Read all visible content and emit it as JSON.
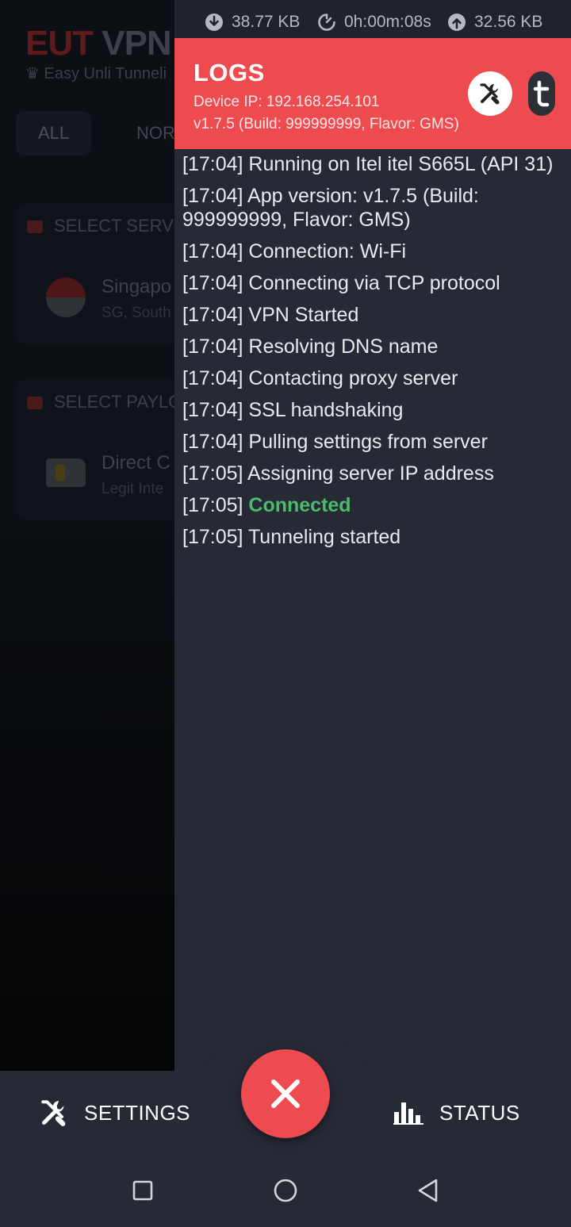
{
  "background_app": {
    "title_part1": "EUT",
    "title_part2": "VPN",
    "subtitle": "♛ Easy Unli Tunneli",
    "tabs": [
      "ALL",
      "NOR"
    ],
    "server_section": "SELECT SERV",
    "server_name": "Singapo",
    "server_sub": "SG, South",
    "payload_section": "SELECT PAYLO",
    "payload_name": "Direct C",
    "payload_sub": "Legit Inte"
  },
  "status_bar": {
    "download": "38.77 KB",
    "duration": "0h:00m:08s",
    "upload": "32.56 KB"
  },
  "logs": {
    "title": "LOGS",
    "device_ip": "Device IP: 192.168.254.101",
    "version_info": "v1.7.5 (Build: 999999999, Flavor: GMS)",
    "entries": [
      {
        "time": "[17:04]",
        "message": "Running on Itel itel S665L (API 31)"
      },
      {
        "time": "[17:04]",
        "message": "App version: v1.7.5 (Build: 999999999, Flavor: GMS)"
      },
      {
        "time": "[17:04]",
        "message": "Connection: Wi-Fi"
      },
      {
        "time": "[17:04]",
        "message": "Connecting via TCP protocol"
      },
      {
        "time": "[17:04]",
        "message": "VPN Started"
      },
      {
        "time": "[17:04]",
        "message": "Resolving DNS name"
      },
      {
        "time": "[17:04]",
        "message": "Contacting proxy server"
      },
      {
        "time": "[17:04]",
        "message": "SSL handshaking"
      },
      {
        "time": "[17:04]",
        "message": "Pulling settings from server"
      },
      {
        "time": "[17:05]",
        "message": "Assigning server IP address"
      },
      {
        "time": "[17:05]",
        "message": "Connected"
      },
      {
        "time": "[17:05]",
        "message": "Tunneling started"
      }
    ]
  },
  "bottom_bar": {
    "settings_label": "SETTINGS",
    "status_label": "STATUS"
  },
  "colors": {
    "accent": "#ee4b50",
    "drawer_bg": "#262a35",
    "connected_green": "#4cbb6c"
  },
  "icons": {
    "download": "download-icon",
    "timer": "timer-icon",
    "upload": "upload-icon",
    "tools": "tools-icon",
    "telegram_t": "t-icon",
    "settings": "tools-icon",
    "status": "bar-chart-icon",
    "disconnect": "close-icon",
    "recents": "square-icon",
    "home": "circle-icon",
    "back": "triangle-icon"
  }
}
